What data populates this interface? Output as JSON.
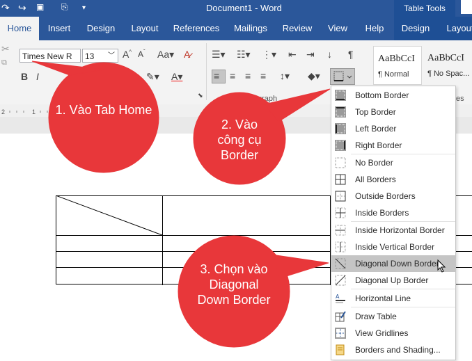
{
  "window": {
    "title": "Document1 - Word",
    "context_title": "Table Tools"
  },
  "tabs": [
    {
      "label": "Home"
    },
    {
      "label": "Insert"
    },
    {
      "label": "Design"
    },
    {
      "label": "Layout"
    },
    {
      "label": "References"
    },
    {
      "label": "Mailings"
    },
    {
      "label": "Review"
    },
    {
      "label": "View"
    },
    {
      "label": "Help"
    },
    {
      "label": "Design"
    },
    {
      "label": "Layout"
    }
  ],
  "ribbon": {
    "font_name": "Times New R",
    "font_size": "13",
    "styles": [
      {
        "sample": "AaBbCcI",
        "name": "¶ Normal"
      },
      {
        "sample": "AaBbCcI",
        "name": "¶ No Spac..."
      }
    ],
    "group_paragraph": "graph",
    "group_styles": "es"
  },
  "border_menu": {
    "items": [
      {
        "label": "Bottom Border",
        "icon": "bottom-border-icon"
      },
      {
        "label": "Top Border",
        "icon": "top-border-icon"
      },
      {
        "label": "Left Border",
        "icon": "left-border-icon"
      },
      {
        "label": "Right Border",
        "icon": "right-border-icon"
      },
      {
        "label": "No Border",
        "icon": "no-border-icon"
      },
      {
        "label": "All Borders",
        "icon": "all-borders-icon"
      },
      {
        "label": "Outside Borders",
        "icon": "outside-borders-icon"
      },
      {
        "label": "Inside Borders",
        "icon": "inside-borders-icon"
      },
      {
        "label": "Inside Horizontal Border",
        "icon": "inside-horizontal-border-icon"
      },
      {
        "label": "Inside Vertical Border",
        "icon": "inside-vertical-border-icon"
      },
      {
        "label": "Diagonal Down Border",
        "icon": "diagonal-down-border-icon",
        "highlighted": true
      },
      {
        "label": "Diagonal Up Border",
        "icon": "diagonal-up-border-icon"
      },
      {
        "label": "Horizontal Line",
        "icon": "horizontal-line-icon"
      },
      {
        "label": "Draw Table",
        "icon": "draw-table-icon"
      },
      {
        "label": "View Gridlines",
        "icon": "view-gridlines-icon"
      },
      {
        "label": "Borders and Shading...",
        "icon": "borders-shading-icon"
      }
    ]
  },
  "callouts": {
    "step1": "1. Vào Tab Home",
    "step2": "2. Vào công cụ Border",
    "step3": "3. Chọn vào Diagonal Down Border"
  },
  "ruler_ticks": [
    "2",
    "1"
  ],
  "colors": {
    "accent": "#2b579a",
    "callout": "#e8373a",
    "menu_highlight": "#c5c5c5"
  }
}
